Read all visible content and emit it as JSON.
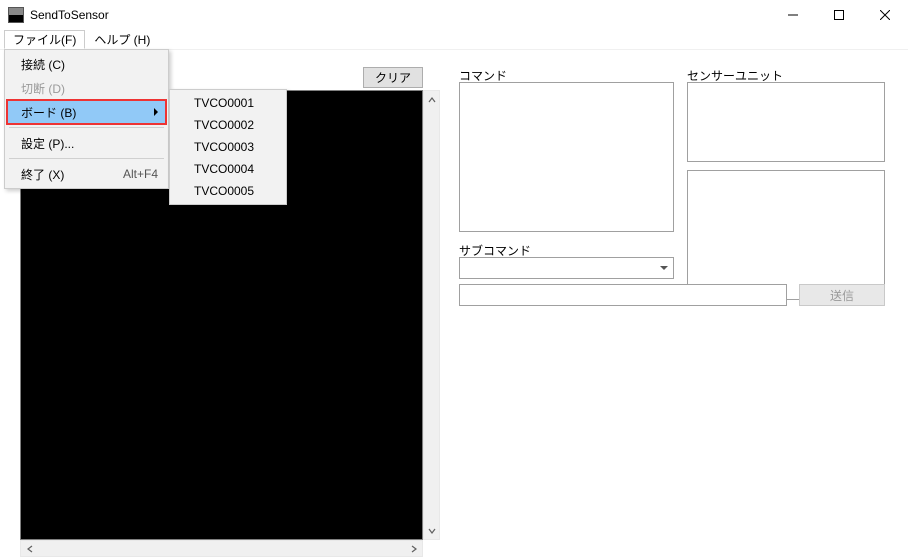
{
  "window": {
    "title": "SendToSensor"
  },
  "menubar": {
    "file": "ファイル(F)",
    "help": "ヘルプ (H)"
  },
  "file_menu": {
    "connect": "接続 (C)",
    "disconnect": "切断 (D)",
    "board": "ボード (B)",
    "settings": "設定 (P)...",
    "exit": "終了 (X)",
    "exit_accel": "Alt+F4"
  },
  "board_submenu": {
    "items": [
      "TVCO0001",
      "TVCO0002",
      "TVCO0003",
      "TVCO0004",
      "TVCO0005"
    ]
  },
  "buttons": {
    "clear": "クリア",
    "send": "送信"
  },
  "labels": {
    "command": "コマンド",
    "sensor_unit": "センサーユニット",
    "subcommand": "サブコマンド"
  }
}
